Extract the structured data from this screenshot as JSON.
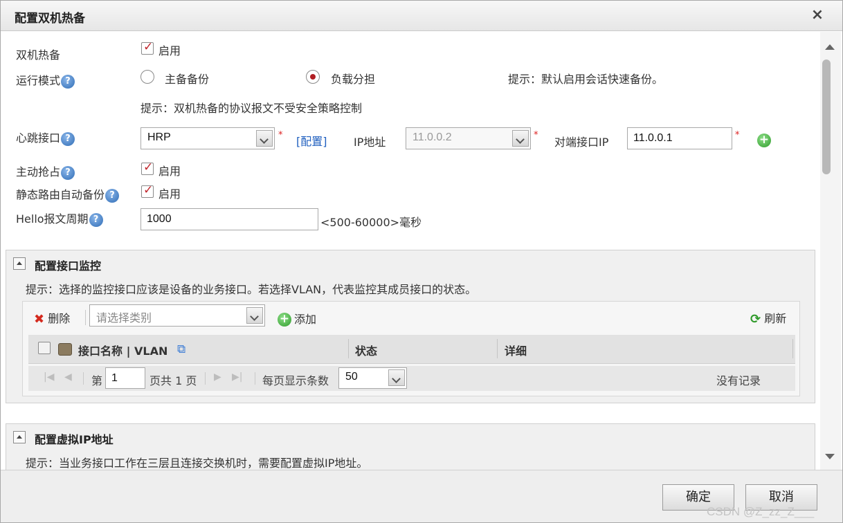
{
  "dialog": {
    "title": "配置双机热备",
    "close": "×"
  },
  "form": {
    "hrp_label": "双机热备",
    "hrp_enable": "启用",
    "run_mode_label": "运行模式",
    "mode_active_standby": "主备备份",
    "mode_load_sharing": "负载分担",
    "mode_hint": "提示：默认启用会话快速备份。",
    "policy_hint": "提示：双机热备的协议报文不受安全策略控制",
    "heartbeat_label": "心跳接口",
    "heartbeat_value": "HRP",
    "config_link": "[配置]",
    "ip_label": "IP地址",
    "ip_value": "11.0.0.2",
    "peer_ip_label": "对端接口IP",
    "peer_ip_value": "11.0.0.1",
    "preempt_label": "主动抢占",
    "preempt_enable": "启用",
    "static_route_label": "静态路由自动备份",
    "static_route_enable": "启用",
    "hello_label": "Hello报文周期",
    "hello_value": "1000",
    "hello_range": "<500-60000>毫秒",
    "help_mark": "?",
    "required_mark": "*",
    "add_mark": "+"
  },
  "interface_monitor": {
    "title": "配置接口监控",
    "hint": "提示：选择的监控接口应该是设备的业务接口。若选择VLAN，代表监控其成员接口的状态。",
    "toolbar": {
      "delete": "删除",
      "category_placeholder": "请选择类别",
      "add": "添加",
      "refresh": "刷新"
    },
    "columns": [
      "接口名称 | VLAN",
      "状态",
      "详细"
    ],
    "pager": {
      "page_prefix": "第",
      "page_value": "1",
      "page_total": "页共 1 页",
      "per_page_label": "每页显示条数",
      "per_page_value": "50",
      "no_records": "没有记录",
      "first": "|◀",
      "prev": "◀",
      "next": "▶",
      "last": "▶|"
    }
  },
  "virtual_ip": {
    "title": "配置虚拟IP地址",
    "hint": "提示：当业务接口工作在三层且连接交换机时，需要配置虚拟IP地址。"
  },
  "footer": {
    "ok": "确定",
    "cancel": "取消",
    "watermark": "CSDN @Z_zz_Z___"
  }
}
